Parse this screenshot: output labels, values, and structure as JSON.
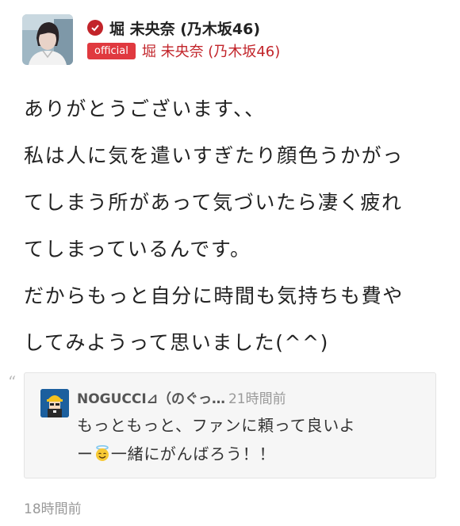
{
  "post": {
    "author_name": "堀 未央奈 (乃木坂46)",
    "badge_label": "official",
    "sub_name": "堀 未央奈 (乃木坂46)",
    "body_lines": [
      "ありがとうございます、、",
      "私は人に気を遣いすぎたり顔色うかがっ",
      "てしまう所があって気づいたら凄く疲れ",
      "てしまっているんです。",
      "だからもっと自分に時間も気持ちも費や",
      "してみようって思いました(^^)"
    ],
    "timestamp": "18時間前"
  },
  "reply": {
    "author": "NOGUCCI⊿（のぐっ…",
    "time": "21時間前",
    "line1": "もっともっと、ファンに頼って良いよ",
    "line2_prefix": "ー",
    "line2_suffix": "一緒にがんばろう！！"
  },
  "icons": {
    "verified": "verified-check-icon",
    "quote": "quote-mark-icon",
    "emoji": "smiling-face-with-halo-icon"
  },
  "colors": {
    "accent_red": "#c2242a",
    "badge_red": "#e0393f",
    "muted_gray": "#999999",
    "reply_bg": "#f6f6f6"
  }
}
